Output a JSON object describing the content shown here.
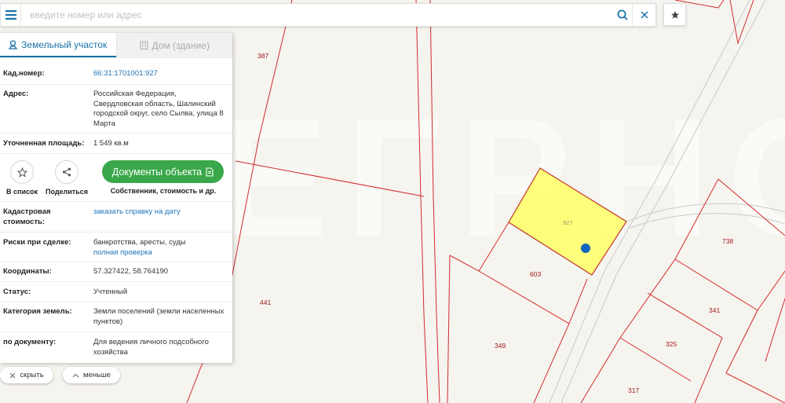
{
  "search": {
    "placeholder": "введите номер или адрес"
  },
  "tabs": {
    "land": "Земельный участок",
    "house": "Дом (здание)"
  },
  "fields": {
    "cadnum_label": "Кад.номер:",
    "cadnum_value": "66:31:1701001:927",
    "address_label": "Адрес:",
    "address_value": "Российская Федерация, Свердловская область, Шалинский городской округ, село Сылва, улица 8 Марта",
    "area_label": "Уточненная площадь:",
    "area_value": "1 549 кв.м",
    "cadcost_label": "Кадастровая стоимость:",
    "cadcost_link": "заказать справку на дату",
    "risks_label": "Риски при сделке:",
    "risks_value": "банкротства, аресты, суды",
    "risks_link": "полная проверка",
    "coords_label": "Координаты:",
    "coords_value": "57.327422, 58.764190",
    "status_label": "Статус:",
    "status_value": "Учтенный",
    "category_label": "Категория земель:",
    "category_value": "Земли поселений (земли населенных пунктов)",
    "bydoc_label": "по документу:",
    "bydoc_value": "Для ведения личного подсобного хозяйства"
  },
  "actions": {
    "save_label": "В список",
    "share_label": "Поделиться",
    "docs_button": "Документы объекта",
    "docs_sub": "Собственник, стоимость и др."
  },
  "bottom": {
    "hide": "скрыть",
    "less": "меньше"
  },
  "map": {
    "watermark": "ЕГРНОС",
    "plots": {
      "p387": "387",
      "p441": "441",
      "p927": "927",
      "p603": "603",
      "p349": "349",
      "p738": "738",
      "p341": "341",
      "p325": "325",
      "p317": "317"
    }
  },
  "colors": {
    "accent": "#1a73a8",
    "docs_button": "#3aa84a",
    "selected_plot": "#ffff66",
    "boundary": "#d22b2b",
    "marker": "#1565c0"
  },
  "icons": [
    "menu-icon",
    "search-icon",
    "close-icon",
    "star-icon",
    "land-plot-icon",
    "building-icon",
    "star-outline-icon",
    "share-icon",
    "document-icon",
    "close-small-icon",
    "chevron-up-icon"
  ]
}
